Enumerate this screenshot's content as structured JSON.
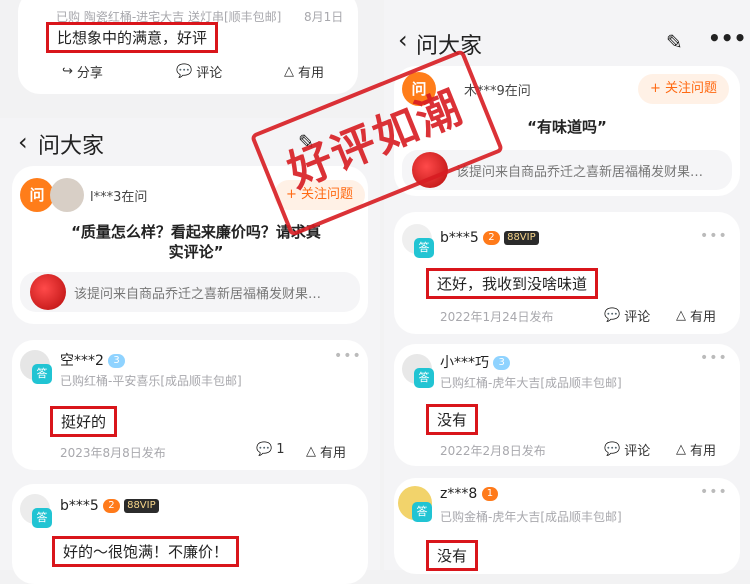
{
  "topleft": {
    "meta": "已购 陶瓷红桶-进宅大吉 送灯串[顺丰包邮]",
    "date": "8月1日",
    "answer": "比想象中的满意，好评",
    "share": "分享",
    "comment": "评论",
    "useful": "有用"
  },
  "left": {
    "title": "问大家",
    "asker": "l***3在问",
    "follow": "+ 关注问题",
    "question": "“质量怎么样？看起来廉价吗？请求真实评论”",
    "product": "该提问来自商品乔迁之喜新居福桶发财果…",
    "answers": [
      {
        "user": "空***2",
        "level": "3",
        "meta": "已购红桶-平安喜乐[成品顺丰包邮]",
        "text": "挺好的",
        "date": "2023年8月8日发布",
        "comments": "1",
        "useful": "有用"
      },
      {
        "user": "b***5",
        "level": "2",
        "vip": "88VIP",
        "text": "好的～很饱满！不廉价！"
      }
    ]
  },
  "right": {
    "title": "问大家",
    "asker": "木***9在问",
    "follow": "+ 关注问题",
    "question": "“有味道吗”",
    "product": "该提问来自商品乔迁之喜新居福桶发财果…",
    "answers": [
      {
        "user": "b***5",
        "level": "2",
        "vip": "88VIP",
        "text": "还好，我收到没啥味道",
        "date": "2022年1月24日发布",
        "comment": "评论",
        "useful": "有用"
      },
      {
        "user": "小***巧",
        "level": "3",
        "meta": "已购红桶-虎年大吉[成品顺丰包邮]",
        "text": "没有",
        "date": "2022年2月8日发布",
        "comment": "评论",
        "useful": "有用"
      },
      {
        "user": "z***8",
        "level": "1",
        "meta": "已购金桶-虎年大吉[成品顺丰包邮]",
        "text": "没有"
      }
    ]
  },
  "badges": {
    "wen": "问",
    "da": "答"
  },
  "stamp": "好评如潮",
  "colors": {
    "accent": "#ff6a13",
    "highlight": "#d9151b",
    "answer_badge": "#21c4d3"
  }
}
